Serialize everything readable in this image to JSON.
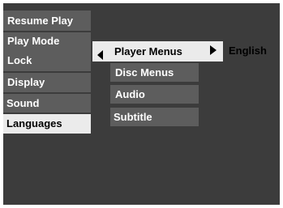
{
  "main_menu": {
    "resume_play": "Resume Play",
    "play_mode": "Play Mode",
    "lock": "Lock",
    "display": "Display",
    "sound": "Sound",
    "languages": "Languages"
  },
  "languages_submenu": {
    "player_menus": "Player Menus",
    "player_menus_value": "English",
    "disc_menus": "Disc Menus",
    "audio": "Audio",
    "subtitle": "Subtitle"
  },
  "colors": {
    "screen_background": "#3c3c3c",
    "item_background": "#5d5d5d",
    "selected_background": "#ebebeb",
    "text": "#ffffff",
    "selected_text": "#000000"
  }
}
